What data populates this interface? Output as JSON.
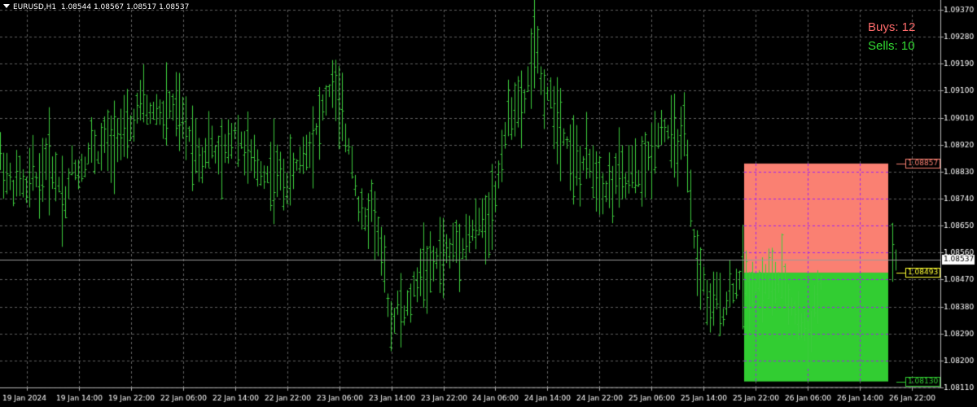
{
  "header": {
    "symbol": "EURUSD,H1",
    "ohlc": "1.08544 1.08567 1.08517 1.08537"
  },
  "legend": {
    "buys": "Buys: 12",
    "sells": "Sells: 10",
    "buys_color": "#ff6b6b",
    "sells_color": "#33dd33"
  },
  "colors": {
    "background": "#000000",
    "grid": "#606060",
    "candle": "#3dcc3d",
    "axis_text": "#ffffff",
    "zone_upper": "#fa8072",
    "zone_lower": "#32cd32"
  },
  "price_axis": {
    "labels": [
      "1.09370",
      "1.09280",
      "1.09190",
      "1.09100",
      "1.09010",
      "1.08920",
      "1.08830",
      "1.08740",
      "1.08650",
      "1.08560",
      "1.08470",
      "1.08380",
      "1.08290",
      "1.08200",
      "1.08110"
    ],
    "min": 1.0811,
    "max": 1.0937
  },
  "time_axis": {
    "labels": [
      "19 Jan 2024",
      "19 Jan 14:00",
      "19 Jan 22:00",
      "22 Jan 06:00",
      "22 Jan 14:00",
      "22 Jan 22:00",
      "23 Jan 06:00",
      "23 Jan 14:00",
      "23 Jan 22:00",
      "24 Jan 06:00",
      "24 Jan 14:00",
      "24 Jan 22:00",
      "25 Jan 06:00",
      "25 Jan 14:00",
      "25 Jan 22:00",
      "26 Jan 06:00",
      "26 Jan 14:00",
      "26 Jan 22:00"
    ]
  },
  "price_markers": [
    {
      "name": "upper-level-marker",
      "label": "1.08857",
      "value": 1.08857,
      "color": "#fa8072"
    },
    {
      "name": "current-price-marker",
      "label": "1.08537",
      "value": 1.08537,
      "color": "#ffffff",
      "text_color": "#000000"
    },
    {
      "name": "middle-level-marker",
      "label": "1.08493",
      "value": 1.08493,
      "color": "#ffff33"
    },
    {
      "name": "lower-level-marker",
      "label": "1.08130",
      "value": 1.0813,
      "color": "#32cd32"
    }
  ],
  "zones": {
    "upper": {
      "top": 1.08857,
      "bottom": 1.08493
    },
    "lower": {
      "top": 1.08493,
      "bottom": 1.0813
    }
  },
  "chart_data": {
    "type": "ohlc",
    "symbol": "EURUSD",
    "timeframe": "H1",
    "y_range": [
      1.0811,
      1.0937
    ],
    "grid": true,
    "close_path": [
      [
        0,
        1.0888
      ],
      [
        8,
        1.0882
      ],
      [
        16,
        1.0878
      ],
      [
        24,
        1.0881
      ],
      [
        32,
        1.0876
      ],
      [
        40,
        1.0883
      ],
      [
        48,
        1.0879
      ],
      [
        56,
        1.0888
      ],
      [
        64,
        1.0884
      ],
      [
        72,
        1.0879
      ],
      [
        80,
        1.0873
      ],
      [
        88,
        1.0885
      ],
      [
        96,
        1.0883
      ],
      [
        104,
        1.0886
      ],
      [
        112,
        1.0892
      ],
      [
        120,
        1.0888
      ],
      [
        128,
        1.0894
      ],
      [
        136,
        1.0891
      ],
      [
        144,
        1.0897
      ],
      [
        152,
        1.0894
      ],
      [
        160,
        1.0897
      ],
      [
        168,
        1.0903
      ],
      [
        176,
        1.0906
      ],
      [
        184,
        1.0902
      ],
      [
        192,
        1.0904
      ],
      [
        200,
        1.0901
      ],
      [
        208,
        1.0905
      ],
      [
        216,
        1.0903
      ],
      [
        224,
        1.0899
      ],
      [
        232,
        1.0896
      ],
      [
        240,
        1.0891
      ],
      [
        248,
        1.0887
      ],
      [
        256,
        1.0893
      ],
      [
        264,
        1.0889
      ],
      [
        272,
        1.0886
      ],
      [
        280,
        1.0892
      ],
      [
        288,
        1.0897
      ],
      [
        296,
        1.0893
      ],
      [
        304,
        1.0889
      ],
      [
        312,
        1.0885
      ],
      [
        320,
        1.0883
      ],
      [
        328,
        1.0882
      ],
      [
        336,
        1.0884
      ],
      [
        344,
        1.0881
      ],
      [
        352,
        1.0879
      ],
      [
        360,
        1.0883
      ],
      [
        368,
        1.0887
      ],
      [
        376,
        1.089
      ],
      [
        384,
        1.0895
      ],
      [
        392,
        1.09
      ],
      [
        400,
        1.0907
      ],
      [
        408,
        1.0913
      ],
      [
        416,
        1.0904
      ],
      [
        424,
        1.0895
      ],
      [
        432,
        1.0888
      ],
      [
        440,
        1.0871
      ],
      [
        448,
        1.0866
      ],
      [
        456,
        1.0873
      ],
      [
        464,
        1.0862
      ],
      [
        472,
        1.0848
      ],
      [
        480,
        1.0832
      ],
      [
        488,
        1.0838
      ],
      [
        496,
        1.0835
      ],
      [
        504,
        1.084
      ],
      [
        512,
        1.0847
      ],
      [
        520,
        1.0852
      ],
      [
        528,
        1.0849
      ],
      [
        536,
        1.0854
      ],
      [
        544,
        1.0856
      ],
      [
        552,
        1.0856
      ],
      [
        560,
        1.086
      ],
      [
        568,
        1.0859
      ],
      [
        576,
        1.0862
      ],
      [
        584,
        1.0864
      ],
      [
        592,
        1.0866
      ],
      [
        600,
        1.0869
      ],
      [
        608,
        1.0874
      ],
      [
        616,
        1.0891
      ],
      [
        624,
        1.09
      ],
      [
        632,
        1.0907
      ],
      [
        640,
        1.0901
      ],
      [
        648,
        1.0913
      ],
      [
        656,
        1.0926
      ],
      [
        664,
        1.0913
      ],
      [
        672,
        1.0909
      ],
      [
        680,
        1.0905
      ],
      [
        688,
        1.0899
      ],
      [
        696,
        1.0893
      ],
      [
        704,
        1.0888
      ],
      [
        712,
        1.0883
      ],
      [
        720,
        1.0887
      ],
      [
        728,
        1.0884
      ],
      [
        736,
        1.0881
      ],
      [
        744,
        1.0877
      ],
      [
        752,
        1.0879
      ],
      [
        760,
        1.0882
      ],
      [
        768,
        1.0879
      ],
      [
        776,
        1.0883
      ],
      [
        784,
        1.0881
      ],
      [
        792,
        1.0885
      ],
      [
        800,
        1.0889
      ],
      [
        808,
        1.0897
      ],
      [
        816,
        1.0898
      ],
      [
        824,
        1.0894
      ],
      [
        832,
        1.0892
      ],
      [
        840,
        1.0894
      ],
      [
        848,
        1.087
      ],
      [
        856,
        1.0852
      ],
      [
        864,
        1.0846
      ],
      [
        872,
        1.0835
      ],
      [
        880,
        1.0841
      ],
      [
        888,
        1.0836
      ],
      [
        896,
        1.0843
      ],
      [
        904,
        1.0845
      ],
      [
        912,
        1.0849
      ],
      [
        920,
        1.0844
      ],
      [
        928,
        1.0847
      ],
      [
        936,
        1.0845
      ],
      [
        944,
        1.0848
      ],
      [
        952,
        1.0845
      ],
      [
        960,
        1.0847
      ],
      [
        968,
        1.084
      ],
      [
        976,
        1.0836
      ],
      [
        984,
        1.0832
      ],
      [
        992,
        1.0827
      ],
      [
        1000,
        1.0838
      ],
      [
        1008,
        1.0846
      ],
      [
        1012,
        1.0845
      ],
      [
        1096,
        1.0853
      ],
      [
        1100,
        1.0854
      ]
    ]
  }
}
